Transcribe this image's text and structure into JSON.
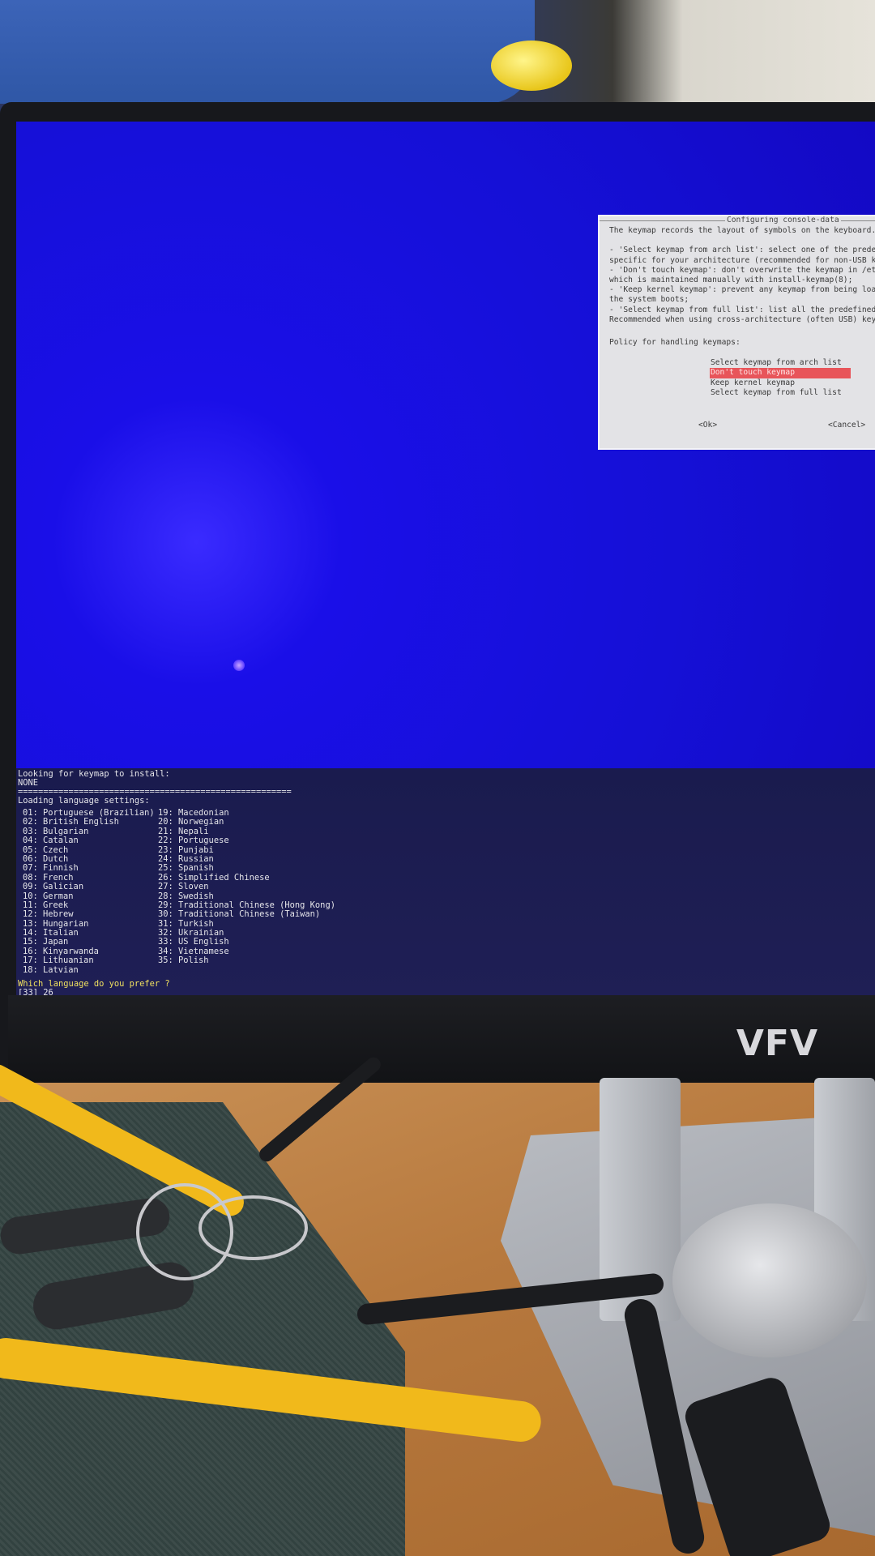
{
  "monitor": {
    "brand": "VFV"
  },
  "dialog": {
    "title": "Configuring console-data",
    "body_lines": [
      "The keymap records the layout of symbols on the keyboard.",
      "",
      " - 'Select keymap from arch list': select one of the predefined keymaps",
      "   specific for your architecture (recommended for non-USB keyboards);",
      " - 'Don't touch keymap': don't overwrite the keymap in /etc/console,",
      "   which is maintained manually with install-keymap(8);",
      " - 'Keep kernel keymap': prevent any keymap from being loaded next time",
      "   the system boots;",
      " - 'Select keymap from full list': list all the predefined keymaps.",
      "   Recommended when using cross-architecture (often USB) keyboards."
    ],
    "prompt": "Policy for handling keymaps:",
    "options": [
      {
        "label": "Select keymap from arch list",
        "selected": false
      },
      {
        "label": "Don't touch keymap",
        "selected": true
      },
      {
        "label": "Keep kernel keymap",
        "selected": false
      },
      {
        "label": "Select keymap from full list",
        "selected": false
      }
    ],
    "ok_label": "<Ok>",
    "cancel_label": "<Cancel>",
    "selected_color": "#e8555a"
  },
  "console": {
    "line1": "Looking for keymap to install:",
    "line2": "NONE",
    "separator": "======================================================",
    "line3": "Loading language settings:",
    "languages_col1": [
      "01: Portuguese (Brazilian)",
      "02: British English",
      "03: Bulgarian",
      "04: Catalan",
      "05: Czech",
      "06: Dutch",
      "07: Finnish",
      "08: French",
      "09: Galician",
      "10: German",
      "11: Greek",
      "12: Hebrew",
      "13: Hungarian",
      "14: Italian",
      "15: Japan",
      "16: Kinyarwanda",
      "17: Lithuanian",
      "18: Latvian"
    ],
    "languages_col2": [
      "19: Macedonian",
      "20: Norwegian",
      "21: Nepali",
      "22: Portuguese",
      "23: Punjabi",
      "24: Russian",
      "25: Spanish",
      "26: Simplified Chinese",
      "27: Sloven",
      "28: Swedish",
      "29: Traditional Chinese (Hong Kong)",
      "30: Traditional Chinese (Taiwan)",
      "31: Turkish",
      "32: Ukrainian",
      "33: US English",
      "34: Vietnamese",
      "35: Polish"
    ],
    "question": "Which language do you prefer ?",
    "input_line": "[33] 26",
    "question_color": "#f0e060"
  }
}
